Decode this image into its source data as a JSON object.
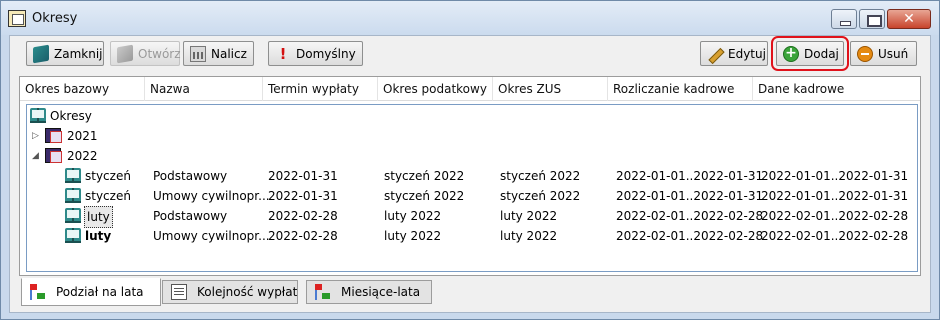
{
  "window": {
    "title": "Okresy"
  },
  "toolbar": {
    "close": "Zamknij",
    "open": "Otwórz",
    "calculate": "Nalicz",
    "default": "Domyślny",
    "edit": "Edytuj",
    "add": "Dodaj",
    "remove": "Usuń"
  },
  "columns": [
    "Okres bazowy",
    "Nazwa",
    "Termin wypłaty",
    "Okres podatkowy",
    "Okres ZUS",
    "Rozliczanie kadrowe",
    "Dane kadrowe"
  ],
  "tree": {
    "root": "Okresy",
    "years": [
      {
        "label": "2021",
        "expanded": false
      },
      {
        "label": "2022",
        "expanded": true
      }
    ],
    "rows": [
      {
        "period": "styczeń",
        "name": "Podstawowy",
        "payday": "2022-01-31",
        "tax": "styczeń 2022",
        "zus": "styczeń 2022",
        "hr_settle": "2022-01-01..2022-01-31",
        "hr_data": "2022-01-01..2022-01-31"
      },
      {
        "period": "styczeń",
        "name": "Umowy cywilnopr...",
        "payday": "2022-01-31",
        "tax": "styczeń 2022",
        "zus": "styczeń 2022",
        "hr_settle": "2022-01-01..2022-01-31",
        "hr_data": "2022-01-01..2022-01-31"
      },
      {
        "period": "luty",
        "name": "Podstawowy",
        "payday": "2022-02-28",
        "tax": "luty 2022",
        "zus": "luty 2022",
        "hr_settle": "2022-02-01..2022-02-28",
        "hr_data": "2022-02-01..2022-02-28"
      },
      {
        "period": "luty",
        "name": "Umowy cywilnopr...",
        "payday": "2022-02-28",
        "tax": "luty 2022",
        "zus": "luty 2022",
        "hr_settle": "2022-02-01..2022-02-28",
        "hr_data": "2022-02-01..2022-02-28"
      }
    ]
  },
  "tabs": [
    "Podział na lata",
    "Kolejność wypłat",
    "Miesiące-lata"
  ],
  "active_tab": "Podział na lata",
  "colors": {
    "highlight_outline": "#e0121b",
    "selection_border": "#7a9cc4"
  }
}
